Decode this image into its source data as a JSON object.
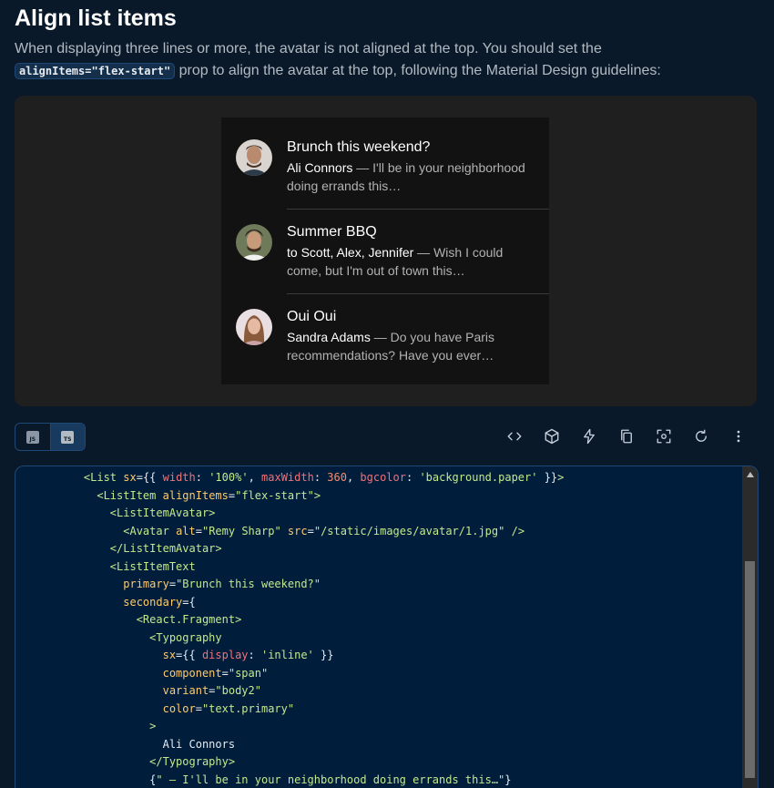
{
  "section": {
    "title": "Align list items",
    "description_before": "When displaying three lines or more, the avatar is not aligned at the top. You should set the",
    "description_code": "alignItems=\"flex-start\"",
    "description_after": " prop to align the avatar at the top, following the Material Design guidelines:"
  },
  "list_items": [
    {
      "avatar_alt": "Remy Sharp",
      "primary": "Brunch this weekend?",
      "secondary_who": "Ali Connors",
      "secondary_text": " — I'll be in your neighborhood doing errands this…"
    },
    {
      "avatar_alt": "Travis Howard",
      "primary": "Summer BBQ",
      "secondary_who": "to Scott, Alex, Jennifer",
      "secondary_text": " — Wish I could come, but I'm out of town this…"
    },
    {
      "avatar_alt": "Cindy Baker",
      "primary": "Oui Oui",
      "secondary_who": "Sandra Adams",
      "secondary_text": " — Do you have Paris recommendations? Have you ever…"
    }
  ],
  "toolbar": {
    "js_label": "JS",
    "ts_label": "TS",
    "tools": [
      "code-icon",
      "codesandbox-icon",
      "stackblitz-icon",
      "copy-icon",
      "focus-icon",
      "reset-icon",
      "more-icon"
    ]
  },
  "code_lines": [
    "    <List sx={{ width: '100%', maxWidth: 360, bgcolor: 'background.paper' }}>",
    "      <ListItem alignItems=\"flex-start\">",
    "        <ListItemAvatar>",
    "          <Avatar alt=\"Remy Sharp\" src=\"/static/images/avatar/1.jpg\" />",
    "        </ListItemAvatar>",
    "        <ListItemText",
    "          primary=\"Brunch this weekend?\"",
    "          secondary={",
    "            <React.Fragment>",
    "              <Typography",
    "                sx={{ display: 'inline' }}",
    "                component=\"span\"",
    "                variant=\"body2\"",
    "                color=\"text.primary\"",
    "              >",
    "                Ali Connors",
    "              </Typography>",
    "              {\" — I'll be in your neighborhood doing errands this…\"}"
  ],
  "colors": {
    "background": "#0a1929",
    "demo_bg": "#1f1f1f",
    "list_bg": "#121212",
    "code_bg": "#001e3c",
    "border": "#1e4976"
  }
}
